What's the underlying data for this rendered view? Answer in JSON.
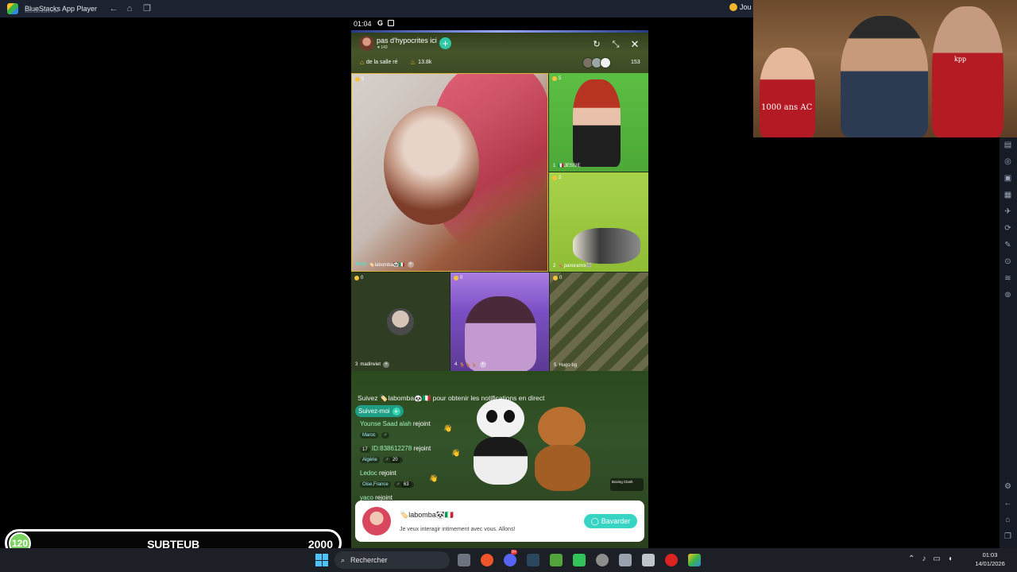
{
  "bluestacks": {
    "title": "BlueStacks App Player",
    "version": "5.22.110.1021 P64",
    "extra_label": "Jou"
  },
  "phone": {
    "status_time": "01:04",
    "room_title": "pas d'hypocrites ici",
    "room_likes": "143",
    "rank_label": "de la salle ré",
    "heat": "13.8k",
    "viewer_count": "153",
    "tiles": {
      "host": {
        "score": "5",
        "tag": "Host",
        "name": "🏷️labomba🐼🇮🇹"
      },
      "t1": {
        "score": "5",
        "seat": "1",
        "name": "🇮🇹JESSIE"
      },
      "t2": {
        "score": "2",
        "seat": "2",
        "name": "🦌panoramix🐺"
      },
      "t3": {
        "score": "0",
        "seat": "3",
        "name": "madinviet"
      },
      "t4": {
        "score": "0",
        "seat": "4",
        "name": "🦌🦌🦌"
      },
      "t5": {
        "score": "0",
        "seat": "5",
        "name": "Hugo bg"
      }
    },
    "chat": {
      "notice": "Suivez 🏷️labomba🐼🇮🇹 pour obtenir les notifications en direct",
      "follow_label": "Suivez-moi",
      "messages": [
        {
          "name": "Younse Saad alah",
          "action": "rejoint",
          "loc": "Maroc",
          "age": ""
        },
        {
          "level": "17",
          "name": "ID:838612278",
          "action": "rejoint",
          "loc": "Algérie",
          "age": "20"
        },
        {
          "name": "Ledoc",
          "action": "rejoint",
          "loc": "Oise,France",
          "age": "63"
        },
        {
          "name": "yaco",
          "action": "rejoint",
          "loc": "",
          "age": ""
        }
      ],
      "boxing_label": "Boxing Clash"
    },
    "invite": {
      "name": "🏷️labomba🐼🇮🇹",
      "message": "Je veux interagir intimement avec vous. Allons!",
      "button": "Bavarder"
    }
  },
  "webcam": {
    "shirt_text": "1000 ans AC",
    "cap_text": "kpp"
  },
  "subgoal": {
    "current": "120",
    "label": "SUBTEUB",
    "goal": "2000"
  },
  "taskbar": {
    "search_placeholder": "Rechercher",
    "discord_badge": "9+",
    "time": "01:03",
    "date": "14/01/2026"
  }
}
